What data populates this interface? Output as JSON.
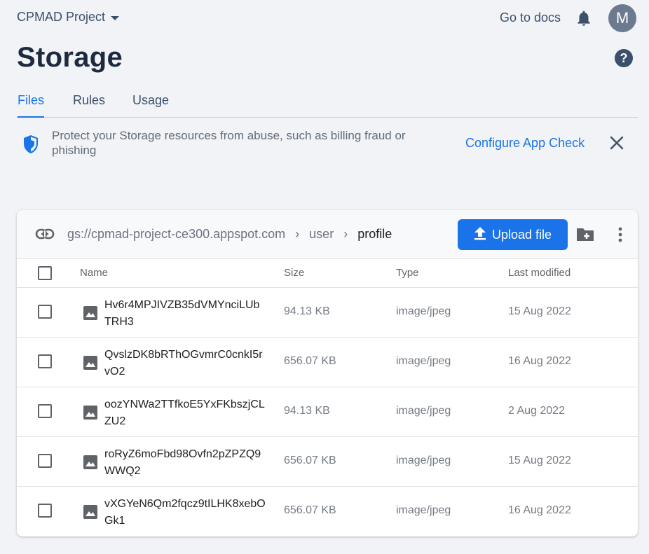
{
  "header": {
    "project": "CPMAD Project",
    "docs_link": "Go to docs",
    "avatar_initial": "M"
  },
  "page": {
    "title": "Storage"
  },
  "tabs": [
    {
      "label": "Files",
      "active": true
    },
    {
      "label": "Rules",
      "active": false
    },
    {
      "label": "Usage",
      "active": false
    }
  ],
  "banner": {
    "text": "Protect your Storage resources from abuse, such as billing fraud or phishing",
    "link": "Configure App Check"
  },
  "browser": {
    "breadcrumb": [
      "gs://cpmad-project-ce300.appspot.com",
      "user",
      "profile"
    ],
    "upload_label": "Upload file"
  },
  "table": {
    "headers": {
      "name": "Name",
      "size": "Size",
      "type": "Type",
      "modified": "Last modified"
    },
    "rows": [
      {
        "name": "Hv6r4MPJIVZB35dVMYnciLUbTRH3",
        "size": "94.13 KB",
        "type": "image/jpeg",
        "modified": "15 Aug 2022"
      },
      {
        "name": "QvslzDK8bRThOGvmrC0cnkI5rvO2",
        "size": "656.07 KB",
        "type": "image/jpeg",
        "modified": "16 Aug 2022"
      },
      {
        "name": "oozYNWa2TTfkoE5YxFKbszjCLZU2",
        "size": "94.13 KB",
        "type": "image/jpeg",
        "modified": "2 Aug 2022"
      },
      {
        "name": "roRyZ6moFbd98Ovfn2pZPZQ9WWQ2",
        "size": "656.07 KB",
        "type": "image/jpeg",
        "modified": "15 Aug 2022"
      },
      {
        "name": "vXGYeN6Qm2fqcz9tILHK8xebOGk1",
        "size": "656.07 KB",
        "type": "image/jpeg",
        "modified": "16 Aug 2022"
      }
    ]
  },
  "colors": {
    "accent": "#1a73e8",
    "title": "#1d2a3f",
    "background": "#f1f3f6"
  }
}
